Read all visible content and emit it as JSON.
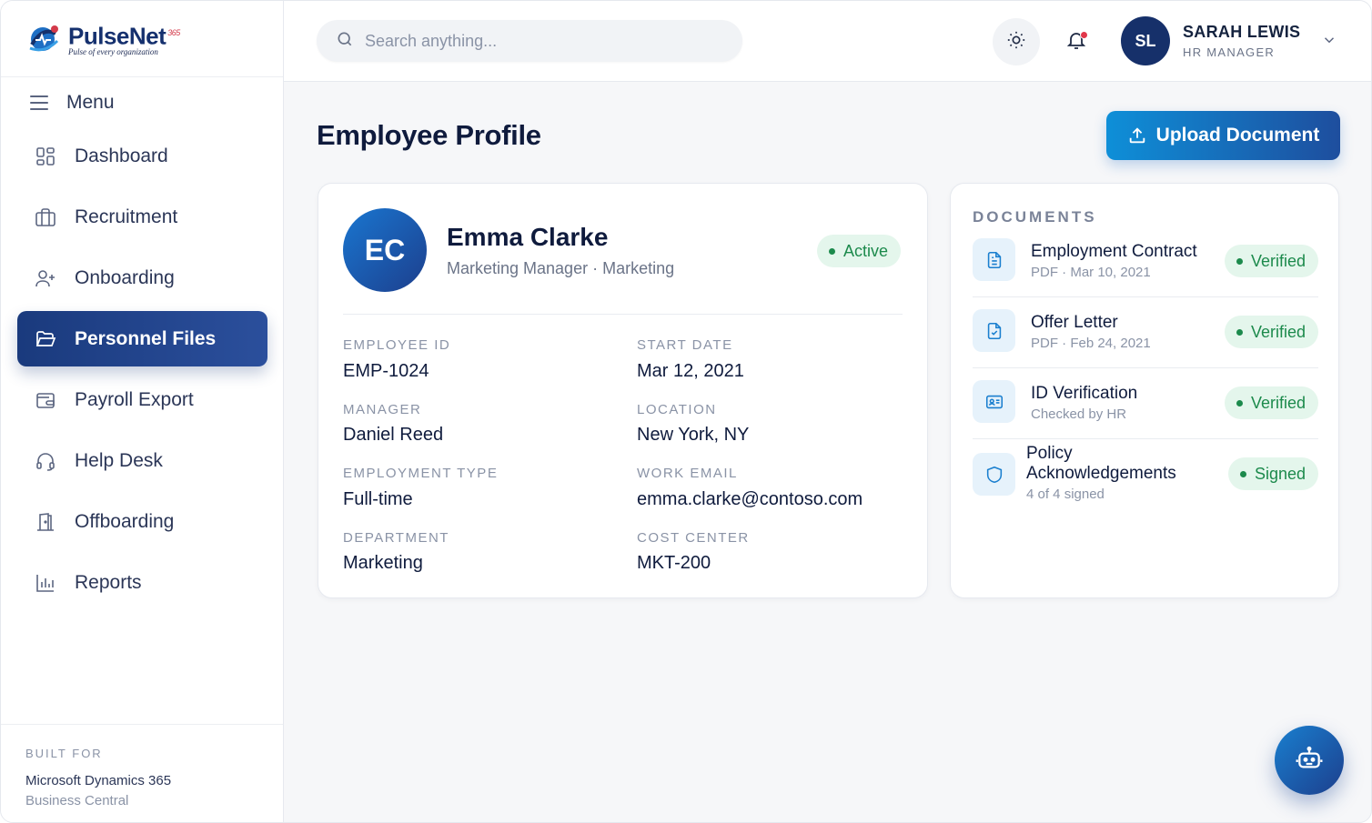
{
  "brand": {
    "name": "PulseNet",
    "suffix": "365",
    "tagline": "Pulse of every organization"
  },
  "sidebar": {
    "menu_label": "Menu",
    "items": [
      {
        "label": "Dashboard",
        "icon": "grid-icon",
        "active": false
      },
      {
        "label": "Recruitment",
        "icon": "briefcase-icon",
        "active": false
      },
      {
        "label": "Onboarding",
        "icon": "user-plus-icon",
        "active": false
      },
      {
        "label": "Personnel Files",
        "icon": "folder-icon",
        "active": true
      },
      {
        "label": "Payroll Export",
        "icon": "wallet-icon",
        "active": false
      },
      {
        "label": "Help Desk",
        "icon": "headset-icon",
        "active": false
      },
      {
        "label": "Offboarding",
        "icon": "door-icon",
        "active": false
      },
      {
        "label": "Reports",
        "icon": "bar-chart-icon",
        "active": false
      }
    ],
    "footer": {
      "label": "BUILT FOR",
      "line1": "Microsoft Dynamics 365",
      "line2": "Business Central"
    }
  },
  "topbar": {
    "search_placeholder": "Search anything...",
    "user": {
      "initials": "SL",
      "name": "SARAH LEWIS",
      "role": "HR MANAGER"
    }
  },
  "main": {
    "title": "Employee Profile",
    "upload_label": "Upload Document"
  },
  "employee": {
    "initials": "EC",
    "name": "Emma Clarke",
    "role_line": "Marketing Manager · Marketing",
    "status": "Active",
    "fields": {
      "employee_id": {
        "label": "EMPLOYEE ID",
        "value": "EMP-1024"
      },
      "start_date": {
        "label": "START DATE",
        "value": "Mar 12, 2021"
      },
      "manager": {
        "label": "MANAGER",
        "value": "Daniel Reed"
      },
      "location": {
        "label": "LOCATION",
        "value": "New York, NY"
      },
      "employment_type": {
        "label": "EMPLOYMENT TYPE",
        "value": "Full-time"
      },
      "work_email": {
        "label": "WORK EMAIL",
        "value": "emma.clarke@contoso.com"
      },
      "department": {
        "label": "DEPARTMENT",
        "value": "Marketing"
      },
      "cost_center": {
        "label": "COST CENTER",
        "value": "MKT-200"
      }
    }
  },
  "documents": {
    "title": "DOCUMENTS",
    "items": [
      {
        "name": "Employment Contract",
        "meta": "PDF · Mar 10, 2021",
        "status": "Verified",
        "icon": "document-icon"
      },
      {
        "name": "Offer Letter",
        "meta": "PDF · Feb 24, 2021",
        "status": "Verified",
        "icon": "file-check-icon"
      },
      {
        "name": "ID Verification",
        "meta": "Checked by HR",
        "status": "Verified",
        "icon": "id-card-icon"
      },
      {
        "name_line1": "Policy",
        "name_line2": "Acknowledgements",
        "meta": "4 of 4 signed",
        "status": "Signed",
        "icon": "shield-icon"
      }
    ]
  },
  "colors": {
    "primary": "#1a3a7d",
    "accent": "#0e8fd8",
    "success": "#1c8a4c",
    "success_bg": "#e4f6ec",
    "notification": "#e1374a"
  }
}
